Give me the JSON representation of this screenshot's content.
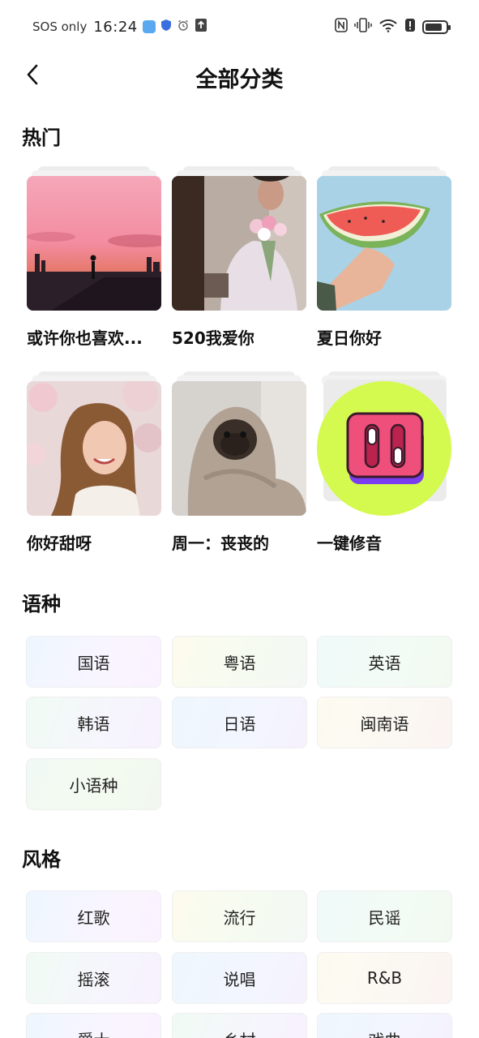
{
  "status_bar": {
    "carrier": "SOS only",
    "time": "16:24",
    "battery_level": 0.85
  },
  "header": {
    "title": "全部分类",
    "back_icon": "chevron-left-icon"
  },
  "hot": {
    "title": "热门",
    "cards": [
      {
        "label": "或许你也喜欢...",
        "cover": "sunset-silhouette"
      },
      {
        "label": "520我爱你",
        "cover": "woman-with-tulips"
      },
      {
        "label": "夏日你好",
        "cover": "watermelon-slice"
      },
      {
        "label": "你好甜呀",
        "cover": "smiling-girl-blossoms"
      },
      {
        "label": "周一：丧丧的",
        "cover": "pug-in-blanket"
      },
      {
        "label": "一键修音",
        "cover": "mixer-toggle-icon"
      }
    ]
  },
  "language": {
    "title": "语种",
    "items": [
      "国语",
      "粤语",
      "英语",
      "韩语",
      "日语",
      "闽南语",
      "小语种"
    ]
  },
  "style": {
    "title": "风格",
    "items": [
      "红歌",
      "流行",
      "民谣",
      "摇滚",
      "说唱",
      "R&B",
      "爵士",
      "乡村",
      "戏曲"
    ]
  }
}
